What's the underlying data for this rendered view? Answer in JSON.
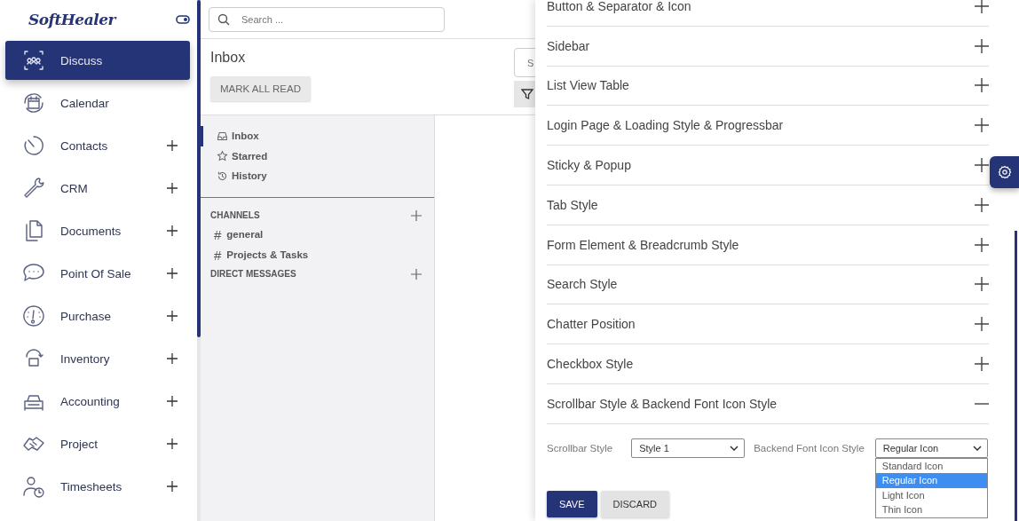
{
  "sidebar": {
    "logo": "SoftHealer",
    "items": [
      {
        "label": "Discuss",
        "selected": true,
        "expandable": false
      },
      {
        "label": "Calendar",
        "selected": false,
        "expandable": false
      },
      {
        "label": "Contacts",
        "selected": false,
        "expandable": true
      },
      {
        "label": "CRM",
        "selected": false,
        "expandable": true
      },
      {
        "label": "Documents",
        "selected": false,
        "expandable": true
      },
      {
        "label": "Point Of Sale",
        "selected": false,
        "expandable": true
      },
      {
        "label": "Purchase",
        "selected": false,
        "expandable": true
      },
      {
        "label": "Inventory",
        "selected": false,
        "expandable": true
      },
      {
        "label": "Accounting",
        "selected": false,
        "expandable": true
      },
      {
        "label": "Project",
        "selected": false,
        "expandable": true
      },
      {
        "label": "Timesheets",
        "selected": false,
        "expandable": true
      }
    ]
  },
  "search": {
    "placeholder": "Search ..."
  },
  "discuss": {
    "title": "Inbox",
    "mark_all_read": "MARK ALL READ",
    "side_search_placeholder": "S",
    "mailboxes": [
      {
        "label": "Inbox",
        "selected": true
      },
      {
        "label": "Starred",
        "selected": false
      },
      {
        "label": "History",
        "selected": false
      }
    ],
    "channels_heading": "CHANNELS",
    "channels": [
      {
        "hash": "#",
        "label": "general"
      },
      {
        "hash": "#",
        "label": "Projects & Tasks"
      }
    ],
    "direct_heading": "DIRECT MESSAGES"
  },
  "settings": {
    "sections": [
      {
        "title": "Button & Separator & Icon",
        "expanded": false
      },
      {
        "title": "Sidebar",
        "expanded": false
      },
      {
        "title": "List View Table",
        "expanded": false
      },
      {
        "title": "Login Page & Loading Style & Progressbar",
        "expanded": false
      },
      {
        "title": "Sticky & Popup",
        "expanded": false
      },
      {
        "title": "Tab Style",
        "expanded": false
      },
      {
        "title": "Form Element & Breadcrumb Style",
        "expanded": false
      },
      {
        "title": "Search Style",
        "expanded": false
      },
      {
        "title": "Chatter Position",
        "expanded": false
      },
      {
        "title": "Checkbox Style",
        "expanded": false
      },
      {
        "title": "Scrollbar Style & Backend Font Icon Style",
        "expanded": true
      }
    ],
    "scrollbar_label": "Scrollbar Style",
    "scrollbar_value": "Style 1",
    "icon_label": "Backend Font Icon Style",
    "icon_value": "Regular Icon",
    "icon_options": [
      {
        "label": "Standard Icon",
        "selected": false
      },
      {
        "label": "Regular Icon",
        "selected": true
      },
      {
        "label": "Light Icon",
        "selected": false
      },
      {
        "label": "Thin Icon",
        "selected": false
      }
    ],
    "save": "SAVE",
    "discard": "DISCARD"
  }
}
